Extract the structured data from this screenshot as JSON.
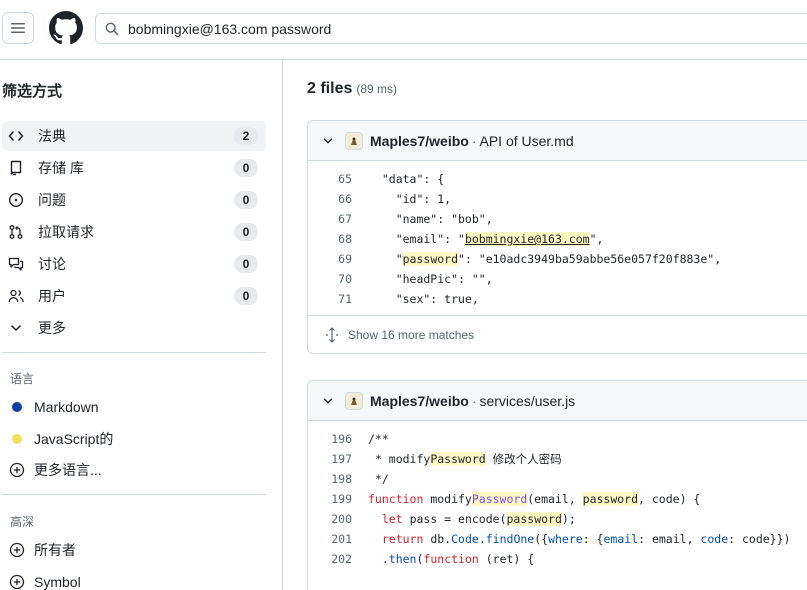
{
  "header": {
    "search_query": "bobmingxie@163.com password"
  },
  "sidebar": {
    "title": "筛选方式",
    "filters": [
      {
        "label": "法典",
        "count": "2"
      },
      {
        "label": "存储 库",
        "count": "0"
      },
      {
        "label": "问题",
        "count": "0"
      },
      {
        "label": "拉取请求",
        "count": "0"
      },
      {
        "label": "讨论",
        "count": "0"
      },
      {
        "label": "用户",
        "count": "0"
      },
      {
        "label": "更多"
      }
    ],
    "languages_title": "语言",
    "languages": [
      {
        "label": "Markdown",
        "color": "#083fa1"
      },
      {
        "label": "JavaScript的",
        "color": "#f1e05a"
      },
      {
        "label": "更多语言..."
      }
    ],
    "advanced_title": "高深",
    "advanced": [
      {
        "label": "所有者"
      },
      {
        "label": "Symbol"
      }
    ]
  },
  "results": {
    "count_label": "2 files",
    "time_label": "(89 ms)",
    "cards": [
      {
        "repo": "Maples7/weibo",
        "separator": "·",
        "file": "API of User.md",
        "lines": [
          {
            "num": "65",
            "segs": [
              {
                "t": "  \"data\": {"
              }
            ]
          },
          {
            "num": "66",
            "segs": [
              {
                "t": "    \"id\": 1,"
              }
            ]
          },
          {
            "num": "67",
            "segs": [
              {
                "t": "    \"name\": \"bob\","
              }
            ]
          },
          {
            "num": "68",
            "segs": [
              {
                "t": "    \"email\": \""
              },
              {
                "t": "bobmingxie@163.com",
                "c": "hl ul"
              },
              {
                "t": "\","
              }
            ]
          },
          {
            "num": "69",
            "segs": [
              {
                "t": "    \""
              },
              {
                "t": "password",
                "c": "hl"
              },
              {
                "t": "\": \"e10adc3949ba59abbe56e057f20f883e\","
              }
            ]
          },
          {
            "num": "70",
            "segs": [
              {
                "t": "    \"headPic\": \"\","
              }
            ]
          },
          {
            "num": "71",
            "segs": [
              {
                "t": "    \"sex\": true,"
              }
            ]
          }
        ],
        "more": "Show 16 more matches"
      },
      {
        "repo": "Maples7/weibo",
        "separator": "·",
        "file": "services/user.js",
        "lines": [
          {
            "num": "196",
            "segs": [
              {
                "t": "/**"
              }
            ]
          },
          {
            "num": "197",
            "segs": [
              {
                "t": " * modify"
              },
              {
                "t": "Password",
                "c": "hl"
              },
              {
                "t": " 修改个人密码"
              }
            ]
          },
          {
            "num": "198",
            "segs": [
              {
                "t": " */"
              }
            ]
          },
          {
            "num": "199",
            "segs": [
              {
                "t": "function",
                "c": "kw"
              },
              {
                "t": " modify"
              },
              {
                "t": "Password",
                "c": "hl fn"
              },
              {
                "t": "(email, "
              },
              {
                "t": "password",
                "c": "hl"
              },
              {
                "t": ", code) {"
              }
            ]
          },
          {
            "num": "200",
            "segs": [
              {
                "t": "  "
              },
              {
                "t": "let",
                "c": "kw"
              },
              {
                "t": " pass = encode("
              },
              {
                "t": "password",
                "c": "hl"
              },
              {
                "t": ");"
              }
            ]
          },
          {
            "num": "201",
            "segs": [
              {
                "t": "  "
              },
              {
                "t": "return",
                "c": "kw"
              },
              {
                "t": " db."
              },
              {
                "t": "Code",
                "c": "prop"
              },
              {
                "t": "."
              },
              {
                "t": "findOne",
                "c": "prop"
              },
              {
                "t": "({"
              },
              {
                "t": "where",
                "c": "prop"
              },
              {
                "t": ": {"
              },
              {
                "t": "email",
                "c": "prop"
              },
              {
                "t": ": email, "
              },
              {
                "t": "code",
                "c": "prop"
              },
              {
                "t": ": code}})"
              }
            ]
          },
          {
            "num": "202",
            "segs": [
              {
                "t": "  ."
              },
              {
                "t": "then",
                "c": "prop"
              },
              {
                "t": "("
              },
              {
                "t": "function",
                "c": "kw"
              },
              {
                "t": " (ret) {"
              }
            ]
          }
        ]
      }
    ]
  }
}
